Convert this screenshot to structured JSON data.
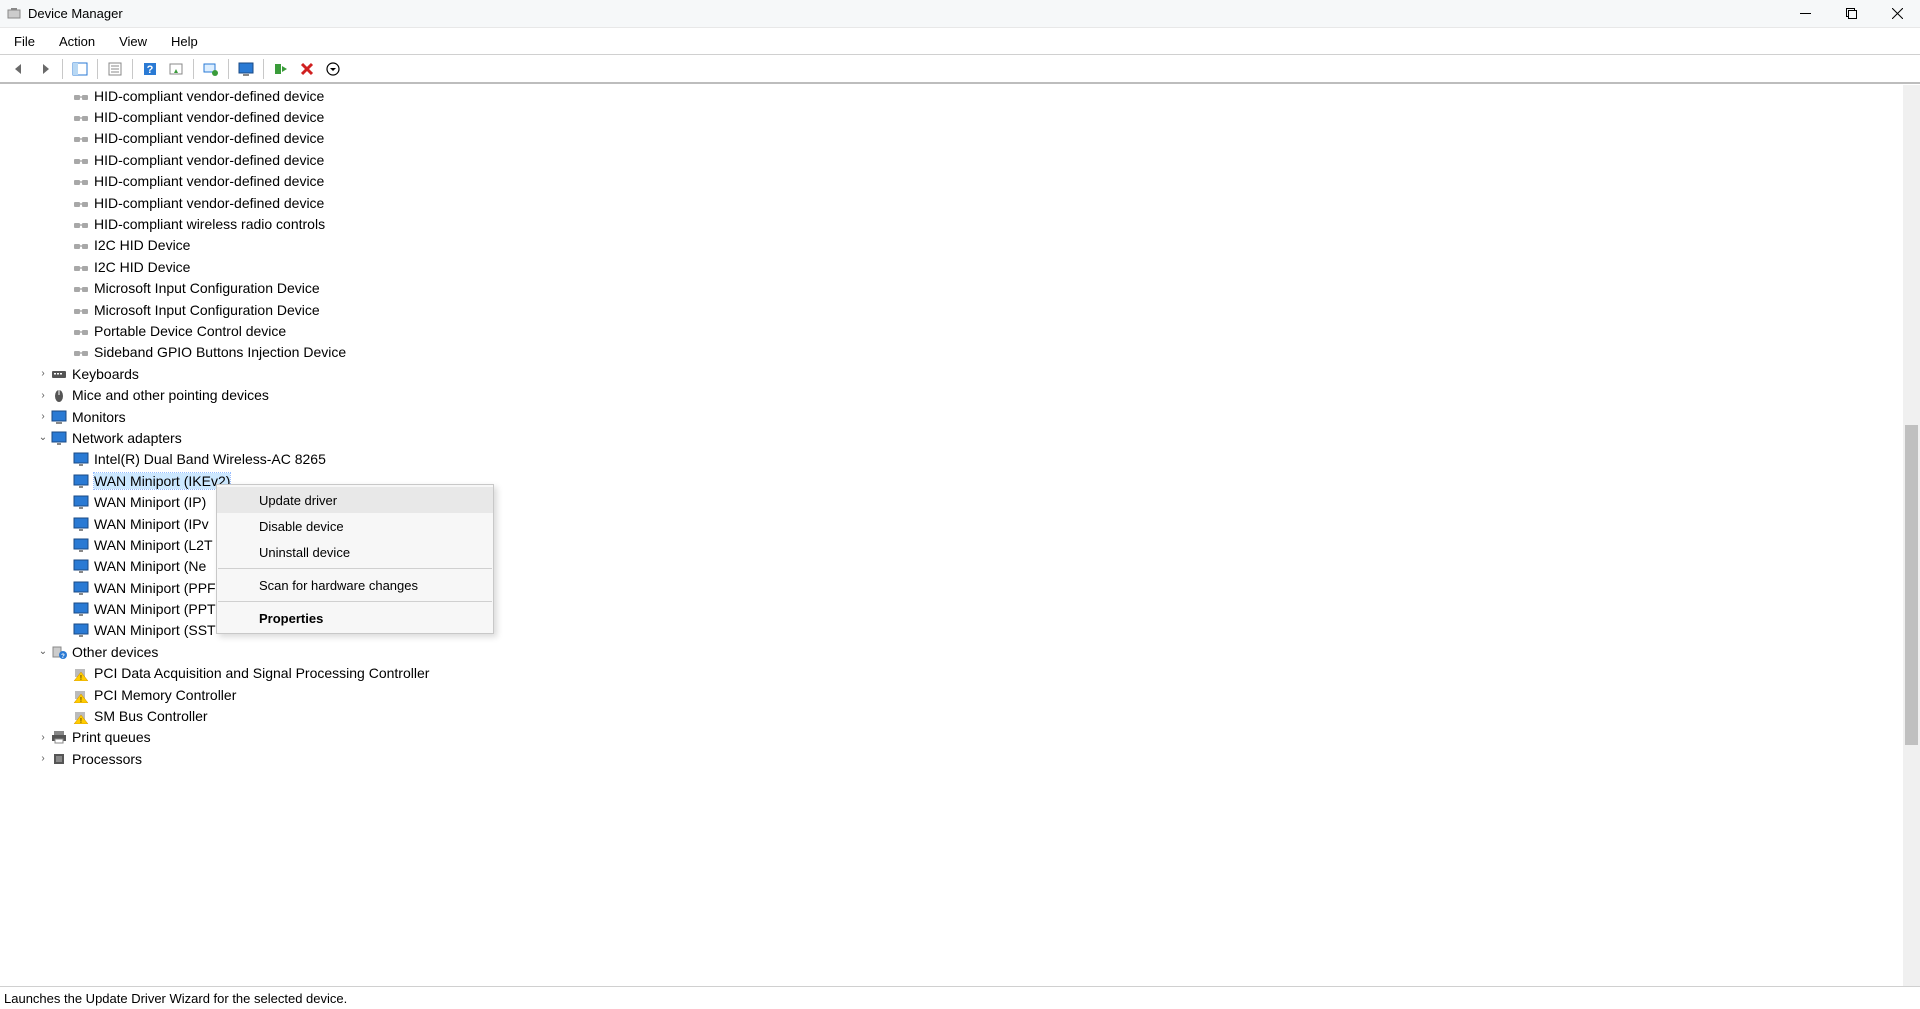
{
  "window": {
    "title": "Device Manager"
  },
  "menu": {
    "file": "File",
    "action": "Action",
    "view": "View",
    "help": "Help"
  },
  "toolbar_icons": [
    "back",
    "forward",
    "sep",
    "show-hide",
    "sep",
    "properties-window",
    "sep",
    "help-icon",
    "update-driver-icon",
    "sep",
    "scan-hardware-icon",
    "sep",
    "monitor-icon",
    "sep",
    "enable-icon",
    "disable-icon",
    "down-icon"
  ],
  "tree": {
    "hid_children": [
      "HID-compliant vendor-defined device",
      "HID-compliant vendor-defined device",
      "HID-compliant vendor-defined device",
      "HID-compliant vendor-defined device",
      "HID-compliant vendor-defined device",
      "HID-compliant vendor-defined device",
      "HID-compliant wireless radio controls",
      "I2C HID Device",
      "I2C HID Device",
      "Microsoft Input Configuration Device",
      "Microsoft Input Configuration Device",
      "Portable Device Control device",
      "Sideband GPIO Buttons Injection Device"
    ],
    "categories": {
      "keyboards": "Keyboards",
      "mice": "Mice and other pointing devices",
      "monitors": "Monitors",
      "network": "Network adapters",
      "other": "Other devices",
      "print": "Print queues",
      "processors": "Processors"
    },
    "network_children": [
      "Intel(R) Dual Band Wireless-AC 8265",
      "WAN Miniport (IKEv2)",
      "WAN Miniport (IP)",
      "WAN Miniport (IPv",
      "WAN Miniport (L2T",
      "WAN Miniport (Ne",
      "WAN Miniport (PPF",
      "WAN Miniport (PPT",
      "WAN Miniport (SST"
    ],
    "network_selected_index": 1,
    "other_children": [
      "PCI Data Acquisition and Signal Processing Controller",
      "PCI Memory Controller",
      "SM Bus Controller"
    ]
  },
  "context_menu": {
    "update": "Update driver",
    "disable": "Disable device",
    "uninstall": "Uninstall device",
    "scan": "Scan for hardware changes",
    "properties": "Properties"
  },
  "status_bar": "Launches the Update Driver Wizard for the selected device."
}
